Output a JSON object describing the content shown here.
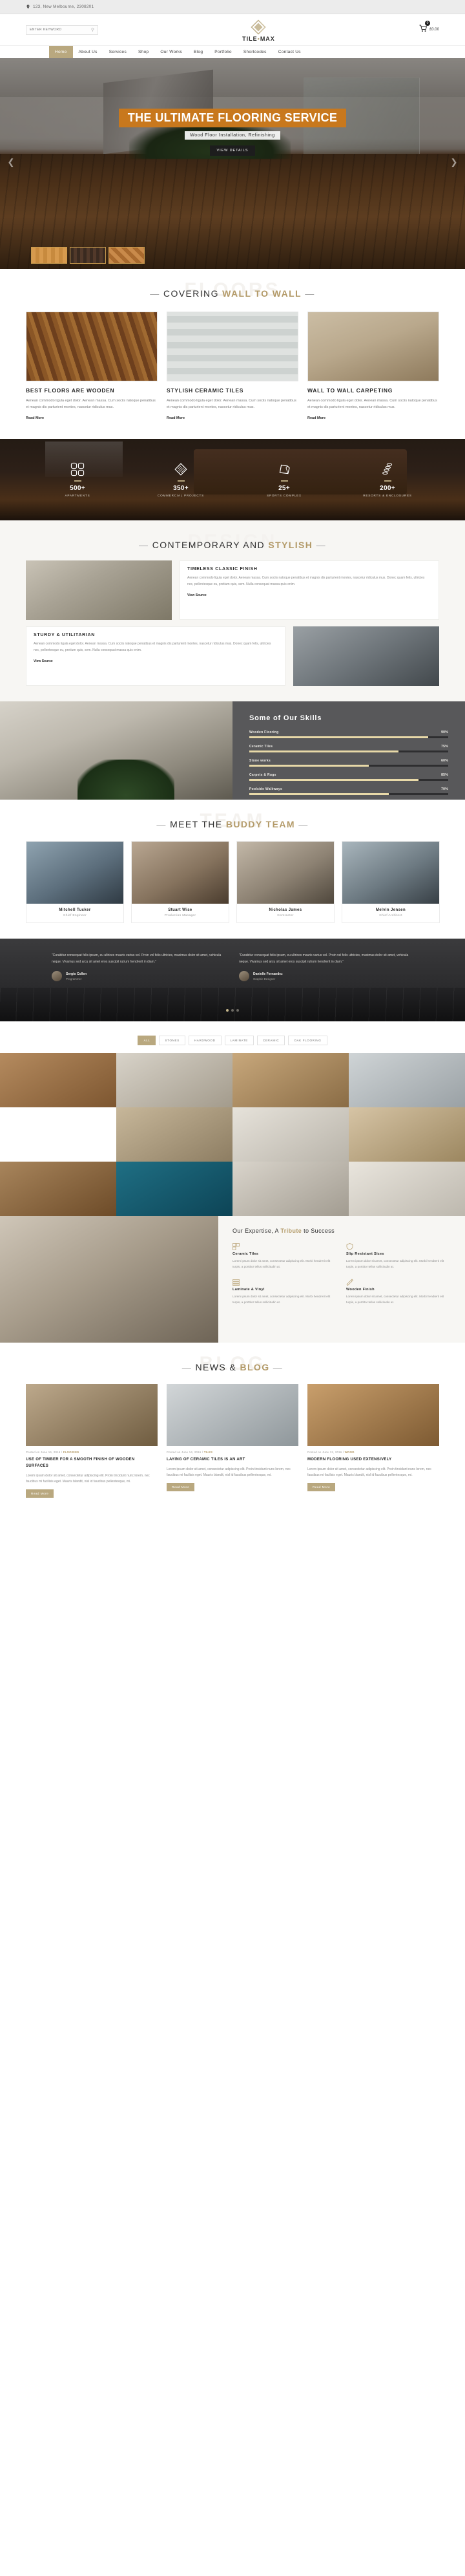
{
  "topbar": {
    "address": "123, New Melbourne, 2308201",
    "pin_icon": "location-pin-icon"
  },
  "header": {
    "search_placeholder": "ENTER KEYWORD",
    "search_value": "",
    "search_icon": "search-icon",
    "logo_main": "TILE",
    "logo_dot": "•",
    "logo_sub": "MAX",
    "cart_icon": "shopping-cart-icon",
    "cart_count": "0",
    "cart_total": "£0.00"
  },
  "nav": {
    "items": [
      {
        "label": "Home",
        "active": true
      },
      {
        "label": "About Us",
        "active": false
      },
      {
        "label": "Services",
        "active": false
      },
      {
        "label": "Shop",
        "active": false
      },
      {
        "label": "Our Works",
        "active": false
      },
      {
        "label": "Blog",
        "active": false
      },
      {
        "label": "Portfolio",
        "active": false
      },
      {
        "label": "Shortcodes",
        "active": false
      },
      {
        "label": "Contact Us",
        "active": false
      }
    ]
  },
  "hero": {
    "title": "THE ULTIMATE FLOORING SERVICE",
    "subtitle": "Wood Floor Installation, Refinishing",
    "button": "VIEW DETAILS",
    "arrow_left": "chevron-left-icon",
    "arrow_right": "chevron-right-icon",
    "swatches": [
      "light-oak-swatch",
      "dark-walnut-swatch",
      "herringbone-swatch"
    ],
    "accent_color": "#c8781d"
  },
  "covering": {
    "ghost": "FLOORS",
    "dash": "—",
    "title_plain": "COVERING",
    "title_accent": "WALL TO WALL",
    "cards": [
      {
        "title": "BEST FLOORS ARE WOODEN",
        "text": "Aenean commodo ligula eget dolor. Aenean massa. Cum sociis natoque penatibus et magnis dis parturient montes, nascetur ridiculus mus.",
        "link": "Read More"
      },
      {
        "title": "STYLISH CERAMIC TILES",
        "text": "Aenean commodo ligula eget dolor. Aenean massa. Cum sociis natoque penatibus et magnis dis parturient montes, nascetur ridiculus mus.",
        "link": "Read More"
      },
      {
        "title": "WALL TO WALL CARPETING",
        "text": "Aenean commodo ligula eget dolor. Aenean massa. Cum sociis natoque penatibus et magnis dis parturient montes, nascetur ridiculus mus.",
        "link": "Read More"
      }
    ]
  },
  "stats": {
    "items": [
      {
        "icon": "four-tiles-icon",
        "number": "500+",
        "label": "APARTMENTS"
      },
      {
        "icon": "parquet-block-icon",
        "number": "350+",
        "label": "COMMERCIAL PROJECTS"
      },
      {
        "icon": "carpet-roll-icon",
        "number": "25+",
        "label": "SPORTS COMPLEX"
      },
      {
        "icon": "stacked-discs-icon",
        "number": "200+",
        "label": "RESORTS & ENCLOSURES"
      }
    ]
  },
  "contemporary": {
    "ghost": "DESIGN",
    "dash": "—",
    "title_plain": "CONTEMPORARY  AND",
    "title_accent": "STYLISH",
    "block_a": {
      "title": "TIMELESS CLASSIC FINISH",
      "text": "Aenean commodo ligula eget dolor. Aenean massa. Cum sociis natoque penatibus et magnis dis parturient montes, nascetur ridiculus mus. Donec quam felis, ultricies nec, pellentesque eu, pretium quis, sem. Nulla consequat massa quis enim.",
      "link": "View Source"
    },
    "block_b": {
      "title": "STURDY & UTILITARIAN",
      "text": "Aenean commodo ligula eget dolor. Aenean massa. Cum sociis natoque penatibus et magnis dis parturient montes, nascetur ridiculus mus. Donec quam felis, ultricies nec, pellentesque eu, pretium quis, sem. Nulla consequat massa quis enim.",
      "link": "View Source"
    }
  },
  "skills": {
    "heading": "Some of Our Skills",
    "bars": [
      {
        "label": "Wooden Flooring",
        "percent": "90%",
        "value": 90
      },
      {
        "label": "Ceramic Tiles",
        "percent": "75%",
        "value": 75
      },
      {
        "label": "Stone works",
        "percent": "60%",
        "value": 60
      },
      {
        "label": "Carpets & Rugs",
        "percent": "85%",
        "value": 85
      },
      {
        "label": "Poolside Walkways",
        "percent": "70%",
        "value": 70
      }
    ]
  },
  "team": {
    "ghost": "TEAM",
    "dash": "—",
    "title_plain": "MEET  THE",
    "title_accent": "BUDDY TEAM",
    "members": [
      {
        "name": "Mitchell Tucker",
        "role": "Chief Engineer"
      },
      {
        "name": "Stuart Wise",
        "role": "Production Manager"
      },
      {
        "name": "Nicholas James",
        "role": "Contractor"
      },
      {
        "name": "Melvin Jensen",
        "role": "Chief Architect"
      }
    ]
  },
  "testimonials": {
    "quotes": [
      {
        "text": "“Curabitur consequat felis ipsum, eu ultrices mauris varius vel. Proin vel felis ultricies, maximus dolor sit amet, vehicula neque. Vivamus sed arcu sit amet eros suscipit rutrum hendrerit in diam.”",
        "name": "Sergio Collen",
        "role": "Programmer"
      },
      {
        "text": "“Curabitur consequat felis ipsum, eu ultrices mauris varius vel. Proin vel felis ultricies, maximus dolor sit amet, vehicula neque. Vivamus sed arcu sit amet eros suscipit rutrum hendrerit in diam.”",
        "name": "Danielle Fernandez",
        "role": "Graphic Designer"
      }
    ],
    "dots": 3,
    "active_dot": 0
  },
  "portfolio": {
    "filters": [
      {
        "label": "ALL",
        "active": true
      },
      {
        "label": "STONES",
        "active": false
      },
      {
        "label": "HARDWOOD",
        "active": false
      },
      {
        "label": "LAMINATE",
        "active": false
      },
      {
        "label": "CERAMIC",
        "active": false
      },
      {
        "label": "OAK FLOORING",
        "active": false
      }
    ]
  },
  "expertise": {
    "title_plain": "Our Expertise, A",
    "title_accent": "Tribute",
    "title_tail": "to Success",
    "items": [
      {
        "icon": "ceramic-tile-icon",
        "title": "Ceramic Tiles",
        "text": "Lorem ipsum dolor sit amet, consectetur adipiscing elit. Morbi hendrerit elit turpis, a porttitor tellus sollicitudin at."
      },
      {
        "icon": "slip-resistant-icon",
        "title": "Slip Resistant Sizes",
        "text": "Lorem ipsum dolor sit amet, consectetur adipiscing elit. Morbi hendrerit elit turpis, a porttitor tellus sollicitudin at."
      },
      {
        "icon": "laminate-vinyl-icon",
        "title": "Laminate & Vinyl",
        "text": "Lorem ipsum dolor sit amet, consectetur adipiscing elit. Morbi hendrerit elit turpis, a porttitor tellus sollicitudin at."
      },
      {
        "icon": "wooden-finish-icon",
        "title": "Wooden Finish",
        "text": "Lorem ipsum dolor sit amet, consectetur adipiscing elit. Morbi hendrerit elit turpis, a porttitor tellus sollicitudin at."
      }
    ]
  },
  "blog": {
    "ghost": "BLOG",
    "dash": "—",
    "title_plain": "NEWS  &",
    "title_accent": "BLOG",
    "posts": [
      {
        "meta_date": "Posted on June 16, 2016",
        "meta_tag": "FLOORING",
        "title": "USE OF TIMBER FOR A SMOOTH FINISH OF WOODEN SURFACES",
        "text": "Lorem ipsum dolor sit amet, consectetur adipiscing elit. Proin tincidunt nunc lorem, nec faucibus mi facilisis eget. Mauris blandit, nisl id faucibus pellentesque, mi.",
        "button": "Read More"
      },
      {
        "meta_date": "Posted on June 14, 2016",
        "meta_tag": "TILES",
        "title": "LAYING OF CERAMIC TILES IS AN ART",
        "text": "Lorem ipsum dolor sit amet, consectetur adipiscing elit. Proin tincidunt nunc lorem, nec faucibus mi facilisis eget. Mauris blandit, nisl id faucibus pellentesque, mi.",
        "button": "Read More"
      },
      {
        "meta_date": "Posted on June 12, 2016",
        "meta_tag": "WOOD",
        "title": "MODERN FLOORING USED EXTENSIVELY",
        "text": "Lorem ipsum dolor sit amet, consectetur adipiscing elit. Proin tincidunt nunc lorem, nec faucibus mi facilisis eget. Mauris blandit, nisl id faucibus pellentesque, mi.",
        "button": "Read More"
      }
    ]
  }
}
